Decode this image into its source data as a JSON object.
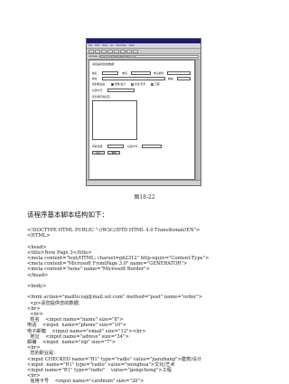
{
  "browser": {
    "menu": [
      "File",
      "Edit",
      "View",
      "Go",
      "Favorites",
      "Help"
    ],
    "address_label": "Address",
    "address_value": "D:\\My Documents\\New Page 3.htm",
    "form": {
      "heading": "请您提供您的数据：",
      "name_label": "姓名：",
      "phone_label": "电话：",
      "email_label": "电子邮件：",
      "address_label": "地址：",
      "zip_label": "邮编：",
      "radio_text": "您的职业是：",
      "radio_options": [
        "建筑/设计",
        "文化/艺术",
        "工程"
      ],
      "comment_label": "您对我们的意见：",
      "card_label": "信用卡号：",
      "expiry_label": "有效日期：",
      "submit": "提交",
      "reset": "重置"
    }
  },
  "caption": "图18-22",
  "intro": "该程序基本脚本结构如下：",
  "code_lines": [
    "<!DOCTYPE HTML PUBLIC \"-//W3C//DTD HTML 4.0 Transitional//EN\">",
    "<HTML>",
    "",
    "<head>",
    "<title>New Page 3</title>",
    "<meta content=\"text/HTML; charset=gb2312\" http-equiv=\"Content-Type\">",
    "<meta content=\"Microsoft FrontPage 3.0\" name=\"GENERATOR\">",
    "<meta content=\"none\" name=\"Microsoft Border\">",
    "</head>",
    "",
    "<body>",
    "",
    "<form action=\"mailto:isg@mail.sot.com\" method=\"post\" name=\"order\">",
    "  <p>请您提供您的数据：",
    "<br>",
    "  <br>",
    "  姓名    <input name=\"name\" size=\"8\">",
    "电话    <input  name=\"phone\" size=\"10\">",
    "电子邮箱    <input name=\"email\" size=\"12\"><br>",
    "  地址    <input name=\"adress\" size=\"34\">",
    "邮编    <input  name=\"zip\" size=\"7\">",
    "<br>",
    "  您的职业是：",
    "<input CHECKED name=\"R1\" type=\"radio\" value=\"jianzhang\">建筑/设计",
    "<input  name=\"R1\" type=\"radio\" value=\"wenghua\">文化/艺术",
    "<input name=\"R1\" type=\"radio\"    value=\"gongcheng\">工程",
    "<br>",
    "  信用卡号    <input name=\"cardnum\" size=\"20\">"
  ]
}
